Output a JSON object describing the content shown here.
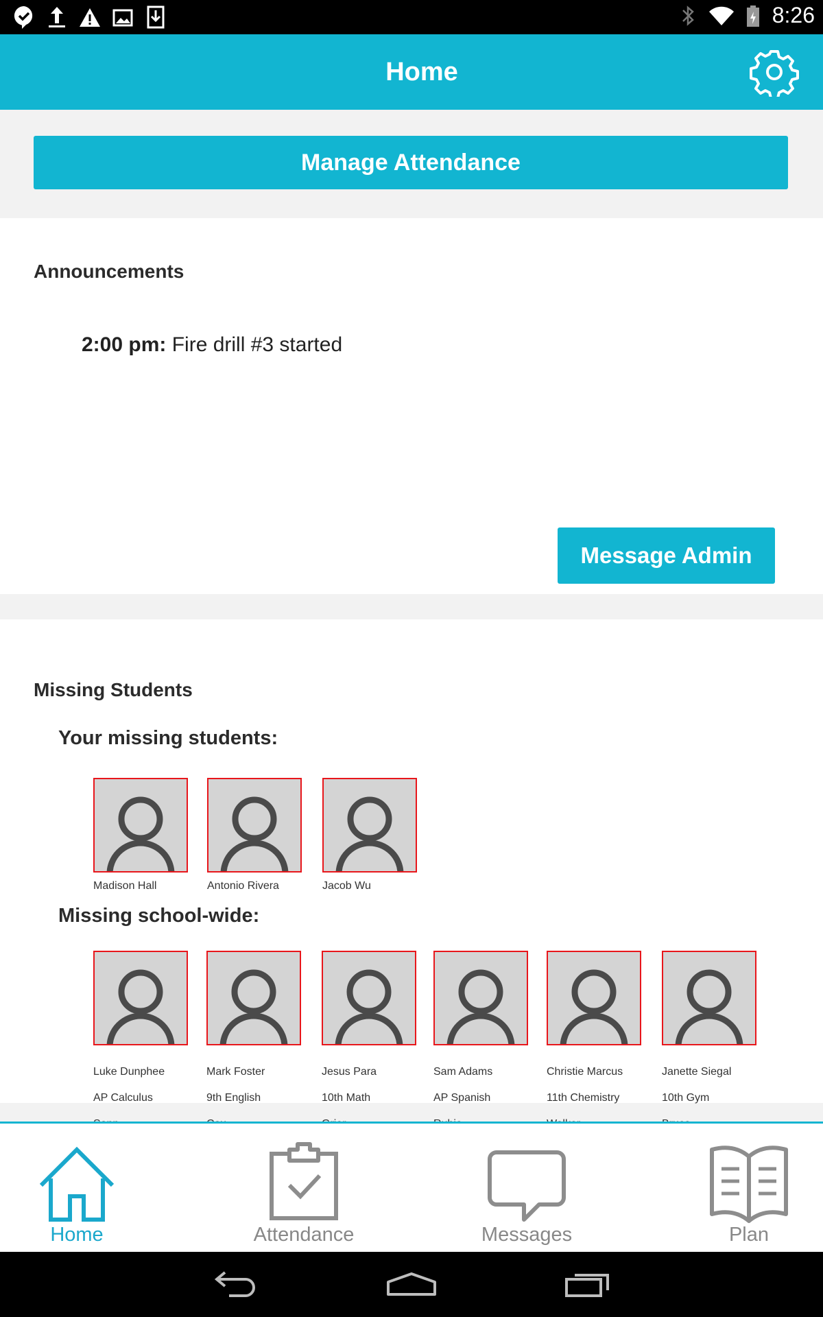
{
  "status_bar": {
    "time": "8:26",
    "left_icons": [
      "hangouts-check-icon",
      "upload-icon",
      "warning-icon",
      "image-icon",
      "download-icon"
    ],
    "right_icons": [
      "bluetooth-icon",
      "wifi-icon",
      "battery-charging-icon"
    ]
  },
  "app_bar": {
    "title": "Home",
    "settings_icon": "gear-icon"
  },
  "main": {
    "manage_attendance_label": "Manage Attendance",
    "announcements": {
      "title": "Announcements",
      "items": [
        {
          "time": "2:00 pm:",
          "text": " Fire drill #3 started"
        }
      ],
      "message_admin_label": "Message Admin"
    },
    "missing": {
      "title": "Missing Students",
      "yours_title": "Your missing students:",
      "yours": [
        {
          "name": "Madison Hall"
        },
        {
          "name": "Antonio Rivera"
        },
        {
          "name": "Jacob Wu"
        }
      ],
      "school_title": "Missing school-wide:",
      "school": [
        {
          "name": "Luke Dunphee",
          "class": "AP Calculus",
          "teacher": "Sapp"
        },
        {
          "name": "Mark Foster",
          "class": "9th English",
          "teacher": "Cox"
        },
        {
          "name": "Jesus Para",
          "class": "10th Math",
          "teacher": "Grier"
        },
        {
          "name": "Sam Adams",
          "class": "AP Spanish",
          "teacher": "Rubio"
        },
        {
          "name": "Christie Marcus",
          "class": "11th Chemistry",
          "teacher": "Walker"
        },
        {
          "name": "Janette Siegal",
          "class": "10th Gym",
          "teacher": "Bruce"
        }
      ]
    }
  },
  "bottom_nav": {
    "items": [
      {
        "label": "Home",
        "icon": "home-icon",
        "active": true
      },
      {
        "label": "Attendance",
        "icon": "clipboard-check-icon",
        "active": false
      },
      {
        "label": "Messages",
        "icon": "speech-bubble-icon",
        "active": false
      },
      {
        "label": "Plan",
        "icon": "book-icon",
        "active": false
      }
    ]
  },
  "system_nav": [
    "back-icon",
    "home-button-icon",
    "recents-icon"
  ],
  "colors": {
    "accent": "#12b5d1",
    "missing_border": "#e8161b",
    "avatar_bg": "#d4d4d4",
    "inactive_nav": "#888888"
  }
}
